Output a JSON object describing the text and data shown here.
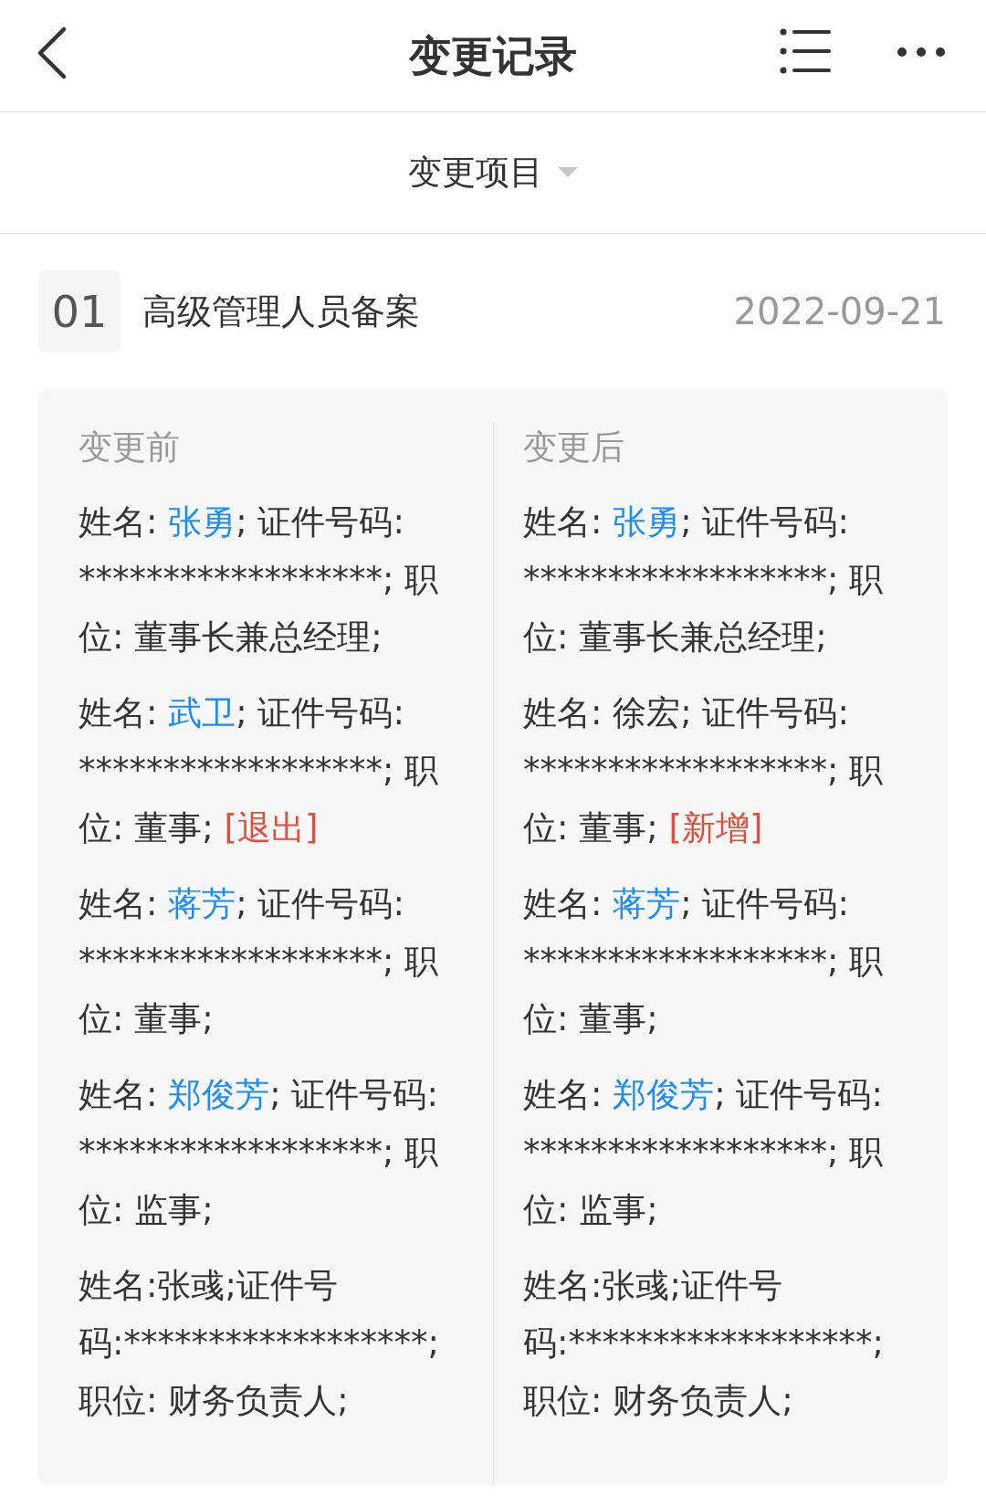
{
  "header": {
    "title": "变更记录"
  },
  "filter": {
    "label": "变更项目"
  },
  "records": [
    {
      "index": "01",
      "title": "高级管理人员备案",
      "date": "2022-09-21",
      "columns": [
        {
          "heading": "变更前",
          "entries": [
            [
              {
                "text": "姓名: "
              },
              {
                "text": "张勇",
                "kind": "link"
              },
              {
                "text": "; 证件号码: ******************; 职位: 董事长兼总经理;"
              }
            ],
            [
              {
                "text": "姓名: "
              },
              {
                "text": "武卫",
                "kind": "link"
              },
              {
                "text": "; 证件号码: ******************; 职位: 董事; "
              },
              {
                "text": "[退出]",
                "kind": "tag"
              }
            ],
            [
              {
                "text": "姓名: "
              },
              {
                "text": "蒋芳",
                "kind": "link"
              },
              {
                "text": "; 证件号码: ******************; 职位: 董事;"
              }
            ],
            [
              {
                "text": "姓名: "
              },
              {
                "text": "郑俊芳",
                "kind": "link"
              },
              {
                "text": "; 证件号码: ******************; 职位: 监事;"
              }
            ],
            [
              {
                "text": "姓名:张彧;证件号码:******************; 职位: 财务负责人;"
              }
            ]
          ]
        },
        {
          "heading": "变更后",
          "entries": [
            [
              {
                "text": "姓名: "
              },
              {
                "text": "张勇",
                "kind": "link"
              },
              {
                "text": "; 证件号码: ******************; 职位: 董事长兼总经理;"
              }
            ],
            [
              {
                "text": "姓名: 徐宏; 证件号码: ******************; 职位: 董事; "
              },
              {
                "text": "[新增]",
                "kind": "tag"
              }
            ],
            [
              {
                "text": "姓名: "
              },
              {
                "text": "蒋芳",
                "kind": "link"
              },
              {
                "text": "; 证件号码: ******************; 职位: 董事;"
              }
            ],
            [
              {
                "text": "姓名: "
              },
              {
                "text": "郑俊芳",
                "kind": "link"
              },
              {
                "text": "; 证件号码: ******************; 职位: 监事;"
              }
            ],
            [
              {
                "text": "姓名:张彧;证件号码:******************; 职位: 财务负责人;"
              }
            ]
          ]
        }
      ]
    }
  ]
}
